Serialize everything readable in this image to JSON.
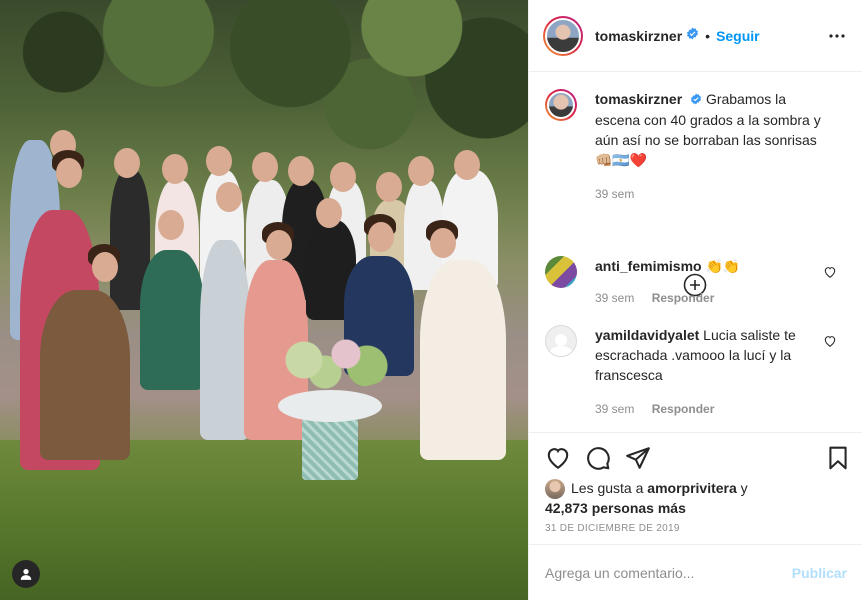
{
  "post": {
    "photo_alt": "group photo",
    "author": "tomaskirzner",
    "follow_label": "Seguir",
    "separator": "•",
    "caption": {
      "user": "tomaskirzner",
      "text": "Grabamos la escena con 40 grados a la sombra y aún así no se borraban las sonrisas 👊🏼🇦🇷❤️",
      "time": "39 sem"
    },
    "comments": [
      {
        "user": "anti_femimismo",
        "text": "👏👏",
        "time": "39 sem",
        "reply_label": "Responder"
      },
      {
        "user": "yamildavidyalet",
        "text": "Lucia saliste te escrachada .vamooo la lucí y la franscesca",
        "time": "39 sem",
        "reply_label": "Responder"
      }
    ],
    "likes": {
      "prefix": "Les gusta a",
      "first_user": "amorprivitera",
      "joiner": "y",
      "others": "42,873 personas más"
    },
    "date": "31 DE DICIEMBRE DE 2019",
    "comment_placeholder": "Agrega un comentario...",
    "publish_label": "Publicar"
  },
  "colors": {
    "accent": "#0095f6",
    "text": "#262626",
    "muted": "#8e8e8e",
    "border": "#efefef"
  }
}
